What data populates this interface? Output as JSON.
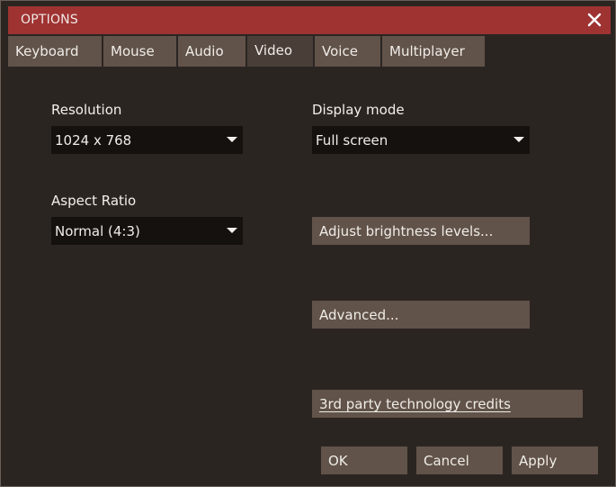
{
  "window": {
    "title": "OPTIONS"
  },
  "tabs": [
    {
      "label": "Keyboard",
      "active": false
    },
    {
      "label": "Mouse",
      "active": false
    },
    {
      "label": "Audio",
      "active": false
    },
    {
      "label": "Video",
      "active": true
    },
    {
      "label": "Voice",
      "active": false
    },
    {
      "label": "Multiplayer",
      "active": false
    }
  ],
  "video": {
    "resolution": {
      "label": "Resolution",
      "value": "1024 x 768"
    },
    "aspect_ratio": {
      "label": "Aspect Ratio",
      "value": "Normal (4:3)"
    },
    "display_mode": {
      "label": "Display mode",
      "value": "Full screen"
    },
    "adjust_brightness_label": "Adjust brightness levels...",
    "advanced_label": "Advanced...",
    "credits_label": "3rd party technology credits"
  },
  "footer": {
    "ok_label": "OK",
    "cancel_label": "Cancel",
    "apply_label": "Apply"
  },
  "colors": {
    "titlebar": "#9e3332",
    "tab": "#615349",
    "tab_active": "#4a3f38",
    "panel": "#2b2522",
    "dropdown": "#15110f",
    "button": "#615349"
  },
  "icons": {
    "close": "close-icon",
    "dropdown": "chevron-down-icon"
  }
}
